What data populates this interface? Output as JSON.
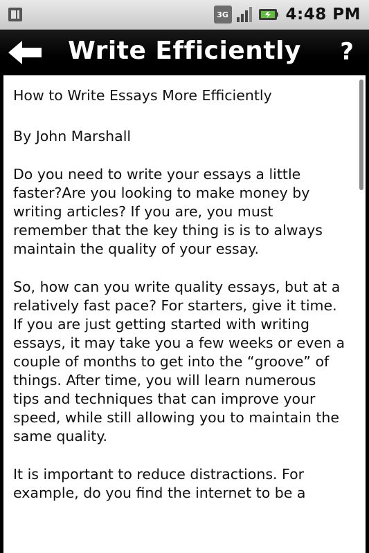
{
  "status_bar": {
    "network_label": "3G",
    "time": "4:48 PM"
  },
  "title_bar": {
    "title": "Write Efficiently",
    "back_icon": "arrow-left-icon",
    "help_label": "?"
  },
  "article": {
    "title": "How to Write Essays More Efficiently",
    "byline": "By John Marshall",
    "paragraphs": [
      "Do you need to write your essays a little faster?Are you looking to make money by writing articles? If you are, you must remember that the key thing is is to always maintain the quality of your essay.",
      "So, how can you write quality essays, but at a relatively fast pace? For starters, give it time. If you are just getting started with writing essays, it may take you a few weeks or even a couple of months to get into the “groove” of things. After time, you will learn numerous tips and techniques that can improve your speed, while still allowing you to maintain the same quality.",
      "It is important to reduce distractions. For example, do you find the internet to be a"
    ]
  }
}
